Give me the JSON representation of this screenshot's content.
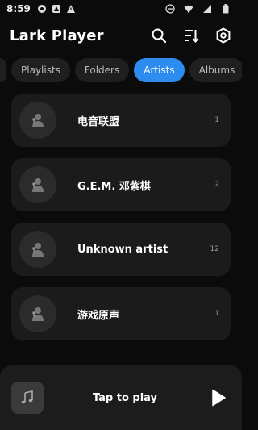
{
  "status_bar": {
    "time": "8:59",
    "icons": [
      "notification-icon",
      "app-icon",
      "warning-icon",
      "dnd-icon",
      "wifi-icon",
      "signal-icon",
      "battery-icon"
    ]
  },
  "header": {
    "title": "Lark Player",
    "actions": [
      "search-icon",
      "sort-icon",
      "settings-icon"
    ]
  },
  "tabs": [
    {
      "label": "Playlists",
      "active": false
    },
    {
      "label": "Folders",
      "active": false
    },
    {
      "label": "Artists",
      "active": true
    },
    {
      "label": "Albums",
      "active": false
    }
  ],
  "artists": [
    {
      "name": "电音联盟",
      "count": "1"
    },
    {
      "name": "G.E.M. 邓紫棋",
      "count": "2"
    },
    {
      "name": "Unknown artist",
      "count": "12"
    },
    {
      "name": "游戏原声",
      "count": "1"
    }
  ],
  "player": {
    "label": "Tap to play"
  },
  "colors": {
    "background": "#0b0b0b",
    "card": "#1b1b1b",
    "accent": "#2c8cf0",
    "tab_inactive": "#1f1f1f"
  }
}
